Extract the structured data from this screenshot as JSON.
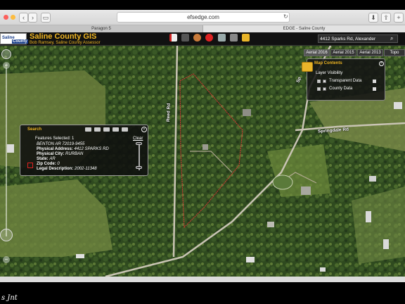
{
  "browser": {
    "url": "efsedge.com",
    "tabs": [
      "Paragon 5",
      "EDGE - Saline County"
    ],
    "back_icon": "chevron-left-icon",
    "forward_icon": "chevron-right-icon"
  },
  "header": {
    "logo_line1": "Saline",
    "logo_line2": "County",
    "title": "Saline County GIS",
    "subtitle": "Bob Ramsey, Saline County Assessor",
    "search_value": "4412 Sparks Rd, Alexander",
    "accent_color": "#f0b623"
  },
  "base_layers": [
    "Aerial 2016",
    "Aerial 2015",
    "Aerial 2013",
    "Topo"
  ],
  "map_contents": {
    "title": "Map Contents",
    "layer_visibility": "Layer Visibility",
    "layers": [
      "Transparent Data",
      "County Data"
    ]
  },
  "search_panel": {
    "title": "Search",
    "features_selected": "Features Selected: 1",
    "clear": "Clear",
    "lines": [
      {
        "label": "",
        "value": "BENTON AR 72019-9455"
      },
      {
        "label": "Physical Address:",
        "value": "4412 SPARKS RD"
      },
      {
        "label": "Physical City:",
        "value": "RURBAN"
      },
      {
        "label": "State:",
        "value": "AR"
      },
      {
        "label": "Zip Code:",
        "value": "0"
      },
      {
        "label": "Legal Description:",
        "value": "2002-11348"
      }
    ]
  },
  "map": {
    "road_labels": [
      "Reed Rd",
      "Springdale Rd",
      "Sp"
    ]
  },
  "watermark": "s Jnt"
}
